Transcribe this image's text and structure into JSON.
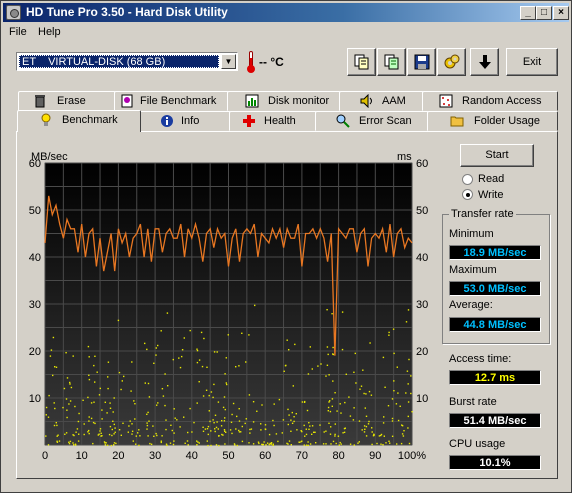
{
  "window": {
    "title": "HD Tune Pro 3.50 - Hard Disk Utility"
  },
  "menu": {
    "file": "File",
    "help": "Help"
  },
  "toolbar": {
    "drive": "ET    VIRTUAL-DISK (68 GB)",
    "temperature": "-- °C",
    "exit_label": "Exit",
    "tools": [
      "copy-info-icon",
      "copy-text-icon",
      "save-icon",
      "options-icon",
      "download-icon"
    ]
  },
  "tabs_row1": [
    "Erase",
    "File Benchmark",
    "Disk monitor",
    "AAM",
    "Random Access"
  ],
  "tabs_row2": [
    "Benchmark",
    "Info",
    "Health",
    "Error Scan",
    "Folder Usage"
  ],
  "benchmark": {
    "start_label": "Start",
    "read_label": "Read",
    "write_label": "Write",
    "mode": "Write",
    "transfer_rate_title": "Transfer rate",
    "minimum_label": "Minimum",
    "minimum_value": "18.9 MB/sec",
    "maximum_label": "Maximum",
    "maximum_value": "53.0 MB/sec",
    "average_label": "Average:",
    "average_value": "44.8 MB/sec",
    "access_time_label": "Access time:",
    "access_time_value": "12.7 ms",
    "burst_rate_label": "Burst rate",
    "burst_rate_value": "51.4 MB/sec",
    "cpu_usage_label": "CPU usage",
    "cpu_usage_value": "10.1%"
  },
  "chart_data": {
    "type": "line",
    "y_left_label": "MB/sec",
    "y_right_label": "ms",
    "ylim": [
      0,
      60
    ],
    "y_ticks": [
      "60",
      "50",
      "40",
      "30",
      "20",
      "10"
    ],
    "x_ticks": [
      "0",
      "10",
      "20",
      "30",
      "40",
      "50",
      "60",
      "70",
      "80",
      "90",
      "100%"
    ],
    "xlim": [
      0,
      100
    ],
    "grid": true,
    "colors": {
      "background": "#000000",
      "grid": "#4a4a4a",
      "transfer": "#e87722",
      "access": "#e8e800"
    },
    "series": [
      {
        "x": [
          0,
          1,
          2,
          3,
          4,
          5,
          6,
          7,
          8,
          9,
          10,
          11,
          12,
          13,
          14,
          15,
          16,
          17,
          18,
          19,
          20,
          21,
          22,
          23,
          24,
          25,
          26,
          27,
          28,
          29,
          30,
          31,
          32,
          33,
          34,
          35,
          36,
          37,
          38,
          39,
          40,
          41,
          42,
          43,
          44,
          45,
          46,
          47,
          48,
          49,
          50,
          51,
          52,
          53,
          54,
          55,
          56,
          57,
          58,
          59,
          60,
          61,
          62,
          63,
          64,
          65,
          66,
          67,
          68,
          69,
          70,
          71,
          72,
          73,
          74,
          75,
          76,
          77,
          78,
          79,
          80,
          81,
          82,
          83,
          84,
          85,
          86,
          87,
          88,
          89,
          90,
          91,
          92,
          93,
          94,
          95,
          96,
          97,
          98,
          99,
          100
        ],
        "values": [
          43,
          53,
          49,
          51,
          47,
          44,
          48,
          46,
          46,
          41,
          47,
          40,
          45,
          46,
          38,
          44,
          37,
          41,
          45,
          37,
          46,
          43,
          45,
          40,
          44,
          45,
          47,
          40,
          46,
          39,
          46,
          46,
          41,
          45,
          46,
          44,
          44,
          47,
          40,
          46,
          44,
          47,
          44,
          39,
          45,
          46,
          42,
          46,
          44,
          45,
          38,
          44,
          46,
          39,
          45,
          46,
          45,
          47,
          40,
          45,
          44,
          43,
          46,
          44,
          46,
          42,
          46,
          44,
          44,
          47,
          38,
          45,
          45,
          46,
          44,
          46,
          44,
          39,
          45,
          19,
          46,
          45,
          44,
          46,
          46,
          41,
          45,
          46,
          38,
          44,
          45,
          44,
          46,
          41,
          47,
          40,
          45,
          46,
          42,
          44,
          43
        ]
      }
    ]
  }
}
